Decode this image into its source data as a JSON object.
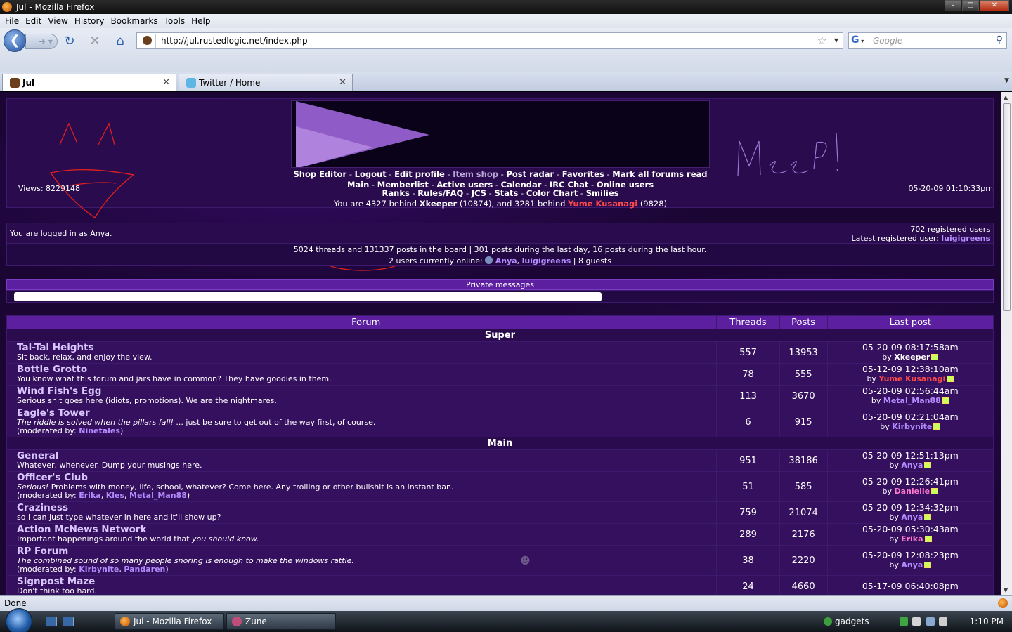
{
  "window": {
    "title": "Jul - Mozilla Firefox"
  },
  "menu": [
    "File",
    "Edit",
    "View",
    "History",
    "Bookmarks",
    "Tools",
    "Help"
  ],
  "nav": {
    "url": "http://jul.rustedlogic.net/index.php",
    "search_placeholder": "Google",
    "back_icon": "back-arrow-icon",
    "forward_icon": "forward-arrow-icon",
    "reload_icon": "reload-icon",
    "stop_icon": "stop-icon",
    "home_icon": "home-icon"
  },
  "tabs": [
    {
      "label": "Jul"
    },
    {
      "label": "Twitter / Home"
    }
  ],
  "header": {
    "row1": [
      "Shop Editor",
      "Logout",
      "Edit profile",
      "Item shop",
      "Post radar",
      "Favorites",
      "Mark all forums read"
    ],
    "row2": [
      "Main",
      "Memberlist",
      "Active users",
      "Calendar",
      "IRC Chat",
      "Online users"
    ],
    "row3": [
      "Ranks",
      "Rules/FAQ",
      "JCS",
      "Stats",
      "Color Chart",
      "Smilies"
    ],
    "views": "Views: 8229148",
    "datetime": "05-20-09 01:10:33pm",
    "behind_prefix": "You are 4327 behind",
    "behind_user1": "Xkeeper",
    "behind_mid": "(10874), and 3281 behind",
    "behind_user2": "Yume Kusanagi",
    "behind_suffix": "(9828)"
  },
  "login": {
    "text": "You are logged in as Anya.",
    "registered": "702 registered users",
    "latest_label": "Latest registered user:",
    "latest_user": "luigigreens"
  },
  "stats": {
    "line1": "5024 threads and 131337 posts in the board | 301 posts during the last day, 16 posts during the last hour.",
    "online_prefix": "2 users currently online:",
    "online_user1": "Anya",
    "online_user2": "luigigreens",
    "online_suffix": "| 8 guests"
  },
  "pm": {
    "header": "Private messages"
  },
  "table": {
    "headers": {
      "forum": "Forum",
      "threads": "Threads",
      "posts": "Posts",
      "last": "Last post"
    },
    "categories": [
      {
        "name": "Super",
        "forums": [
          {
            "name": "Tal-Tal Heights",
            "desc": "Sit back, relax, and enjoy the view.",
            "threads": "557",
            "posts": "13953",
            "last_date": "05-20-09 08:17:58am",
            "last_by": "Xkeeper",
            "by_color": "#ffffff"
          },
          {
            "name": "Bottle Grotto",
            "desc": "You know what this forum and jars have in common? They have goodies in them.",
            "threads": "78",
            "posts": "555",
            "last_date": "05-12-09 12:38:10am",
            "last_by": "Yume Kusanagi",
            "by_color": "#ff4a4a"
          },
          {
            "name": "Wind Fish's Egg",
            "desc": "Serious shit goes here (idiots, promotions). We are the nightmares.",
            "threads": "113",
            "posts": "3670",
            "last_date": "05-20-09 02:56:44am",
            "last_by": "Metal_Man88",
            "by_color": "#b48cff"
          },
          {
            "name": "Eagle's Tower",
            "desc_italic": "The riddle is solved when the pillars fall!",
            "desc": "... just be sure to get out of the way first, of course.",
            "mod_prefix": "(moderated by:",
            "mods": [
              "Ninetales"
            ],
            "threads": "6",
            "posts": "915",
            "last_date": "05-20-09 02:21:04am",
            "last_by": "Kirbynite",
            "by_color": "#b48cff"
          }
        ]
      },
      {
        "name": "Main",
        "forums": [
          {
            "name": "General",
            "desc": "Whatever, whenever. Dump your musings here.",
            "threads": "951",
            "posts": "38186",
            "last_date": "05-20-09 12:51:13pm",
            "last_by": "Anya",
            "by_color": "#b48cff"
          },
          {
            "name": "Officer's Club",
            "desc_italic": "Serious!",
            "desc": "Problems with money, life, school, whatever? Come here. Any trolling or other bullshit is an instant ban.",
            "mod_prefix": "(moderated by:",
            "mods": [
              "Erika",
              "Kles",
              "Metal_Man88"
            ],
            "threads": "51",
            "posts": "585",
            "last_date": "05-20-09 12:26:41pm",
            "last_by": "Danielle",
            "by_color": "#ff7acd"
          },
          {
            "name": "Craziness",
            "desc": "so I can just type whatever in here and it'll show up?",
            "threads": "759",
            "posts": "21074",
            "last_date": "05-20-09 12:34:32pm",
            "last_by": "Anya",
            "by_color": "#b48cff"
          },
          {
            "name": "Action McNews Network",
            "desc": "Important happenings around the world that",
            "desc_italic_after": "you should know.",
            "threads": "289",
            "posts": "2176",
            "last_date": "05-20-09 05:30:43am",
            "last_by": "Erika",
            "by_color": "#ff7acd"
          },
          {
            "name": "RP Forum",
            "desc_italic": "The combined sound of so many people snoring is enough to make the windows rattle.",
            "desc": "",
            "mod_prefix": "(moderated by:",
            "mods": [
              "Kirbynite",
              "Pandaren"
            ],
            "threads": "38",
            "posts": "2220",
            "last_date": "05-20-09 12:08:23pm",
            "last_by": "Anya",
            "by_color": "#b48cff"
          },
          {
            "name": "Signpost Maze",
            "desc": "Don't think too hard.",
            "threads": "24",
            "posts": "4660",
            "last_date": "05-17-09 06:40:08pm",
            "last_by": "",
            "by_color": "#b48cff"
          }
        ]
      }
    ]
  },
  "status": {
    "text": "Done"
  },
  "taskbar": {
    "buttons": [
      "Jul - Mozilla Firefox",
      "Zune"
    ],
    "gadgets": "gadgets",
    "time": "1:10 PM"
  },
  "colors": {
    "page_bg": "#1a0533",
    "header_bar": "#5b1fa0",
    "row_bg": "#35105e",
    "link": "#d9c6ff",
    "user_purple": "#b48cff",
    "user_red": "#ff4a4a"
  }
}
